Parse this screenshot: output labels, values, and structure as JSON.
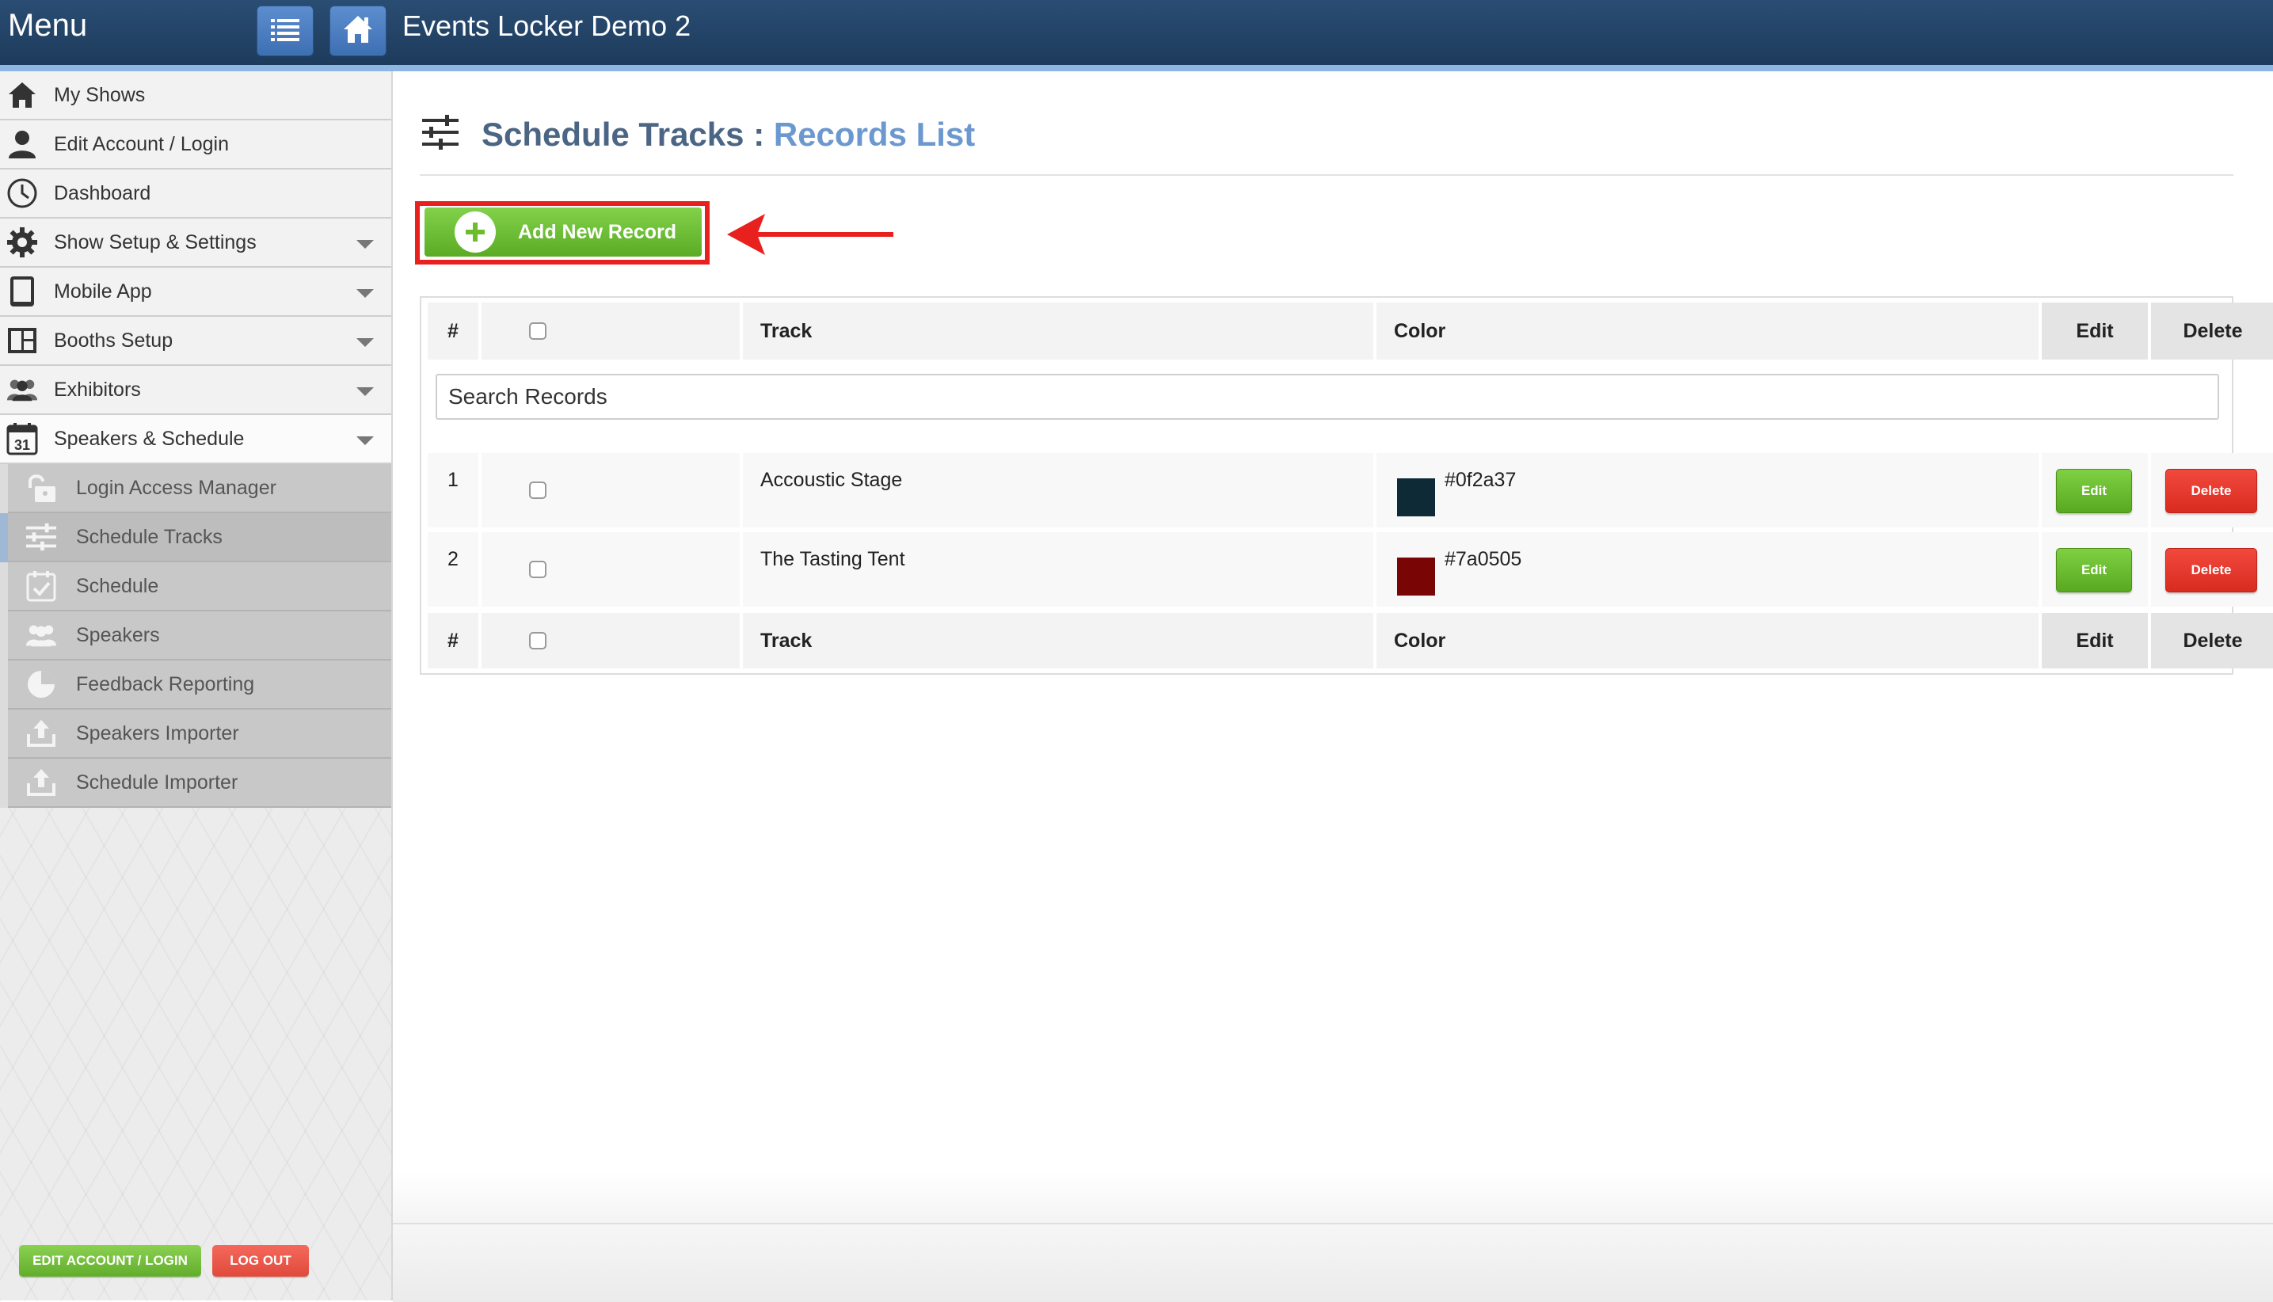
{
  "header": {
    "menu_label": "Menu",
    "app_title": "Events Locker Demo 2",
    "list_button_icon": "list-icon",
    "home_button_icon": "home-icon",
    "bar_color": "#1d3b5c"
  },
  "sidebar": {
    "items": [
      {
        "label": "My Shows",
        "icon": "home-icon"
      },
      {
        "label": "Edit Account / Login",
        "icon": "user-icon"
      },
      {
        "label": "Dashboard",
        "icon": "clock-icon"
      },
      {
        "label": "Show Setup & Settings",
        "icon": "gear-icon"
      },
      {
        "label": "Mobile App",
        "icon": "tablet-icon"
      },
      {
        "label": "Booths Setup",
        "icon": "layout-icon"
      },
      {
        "label": "Exhibitors",
        "icon": "people-icon"
      },
      {
        "label": "Speakers & Schedule",
        "icon": "calendar-icon",
        "calendar_number": "31"
      }
    ],
    "sub_items": [
      {
        "label": "Login Access Manager",
        "icon": "unlock-icon"
      },
      {
        "label": "Schedule Tracks",
        "icon": "sliders-icon",
        "selected": true
      },
      {
        "label": "Schedule",
        "icon": "calendar-check-icon"
      },
      {
        "label": "Speakers",
        "icon": "people-icon"
      },
      {
        "label": "Feedback Reporting",
        "icon": "pie-chart-icon"
      },
      {
        "label": "Speakers Importer",
        "icon": "upload-icon"
      },
      {
        "label": "Schedule Importer",
        "icon": "upload-icon"
      }
    ],
    "edit_account_button": "EDIT ACCOUNT / LOGIN",
    "logout_button": "LOG OUT"
  },
  "main": {
    "title": "Schedule Tracks",
    "title_separator": ":",
    "subtitle": "Records List",
    "add_button": "Add New Record",
    "search_placeholder": "Search Records",
    "columns": {
      "num": "#",
      "track": "Track",
      "color": "Color",
      "edit": "Edit",
      "delete": "Delete"
    },
    "rows": [
      {
        "num": "1",
        "track": "Accoustic Stage",
        "color": "#0f2a37",
        "edit": "Edit",
        "delete": "Delete"
      },
      {
        "num": "2",
        "track": "The Tasting Tent",
        "color": "#7a0505",
        "edit": "Edit",
        "delete": "Delete"
      }
    ]
  },
  "colors": {
    "accent_green": "#5aab25",
    "accent_red": "#d92b20",
    "title_blue": "#4b6584",
    "subtitle_blue": "#6b98cf",
    "highlight_red": "#e8211f"
  }
}
